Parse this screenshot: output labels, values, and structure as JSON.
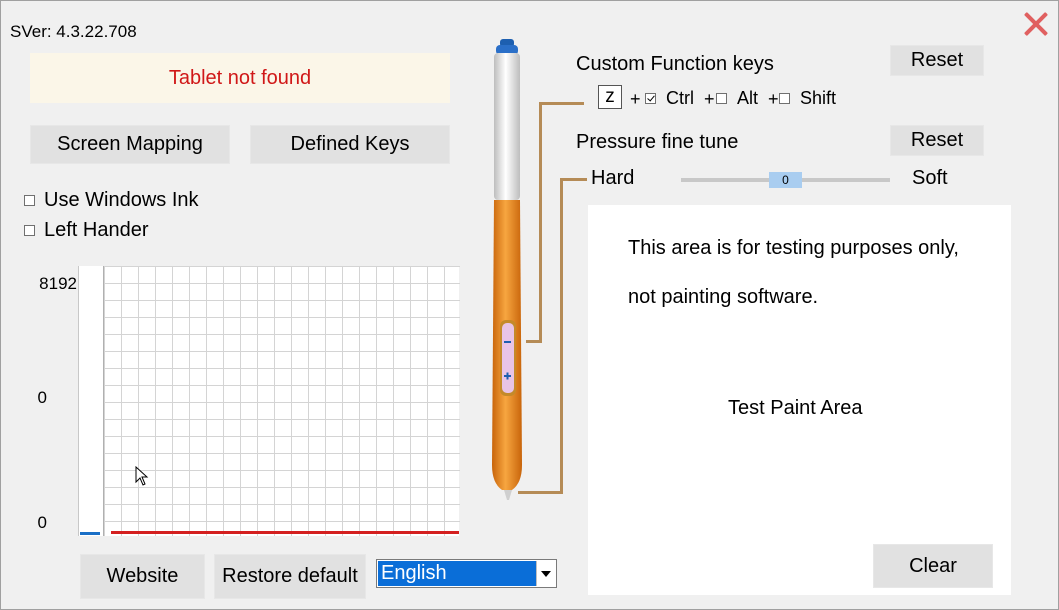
{
  "version": "SVer: 4.3.22.708",
  "status": "Tablet not found",
  "buttons": {
    "screen_mapping": "Screen Mapping",
    "defined_keys": "Defined Keys",
    "website": "Website",
    "restore_default": "Restore default",
    "reset_function": "Reset",
    "reset_pressure": "Reset",
    "clear": "Clear"
  },
  "options": {
    "windows_ink": {
      "label": "Use Windows Ink",
      "checked": false
    },
    "left_hander": {
      "label": "Left Hander",
      "checked": false
    }
  },
  "graph": {
    "y_top": "8192",
    "y_mid": "0",
    "y_bottom": "0"
  },
  "language": {
    "selected": "English"
  },
  "function_keys": {
    "title": "Custom Function keys",
    "key": "z",
    "plus1": "+",
    "ctrl": {
      "label": "Ctrl",
      "checked": true
    },
    "plus2": "+",
    "alt": {
      "label": "Alt",
      "checked": false
    },
    "plus3": "+",
    "shift": {
      "label": "Shift",
      "checked": false
    }
  },
  "pressure": {
    "title": "Pressure fine tune",
    "hard": "Hard",
    "soft": "Soft",
    "value": "0"
  },
  "paint": {
    "line1": "This area is for testing purposes only,",
    "line2": "not painting software.",
    "center": "Test Paint Area"
  },
  "colors": {
    "status_text": "#d01818",
    "selection": "#0a6ed8",
    "pressure_line": "#d42020",
    "pen_body": "#e8861e",
    "close": "#e06060"
  }
}
